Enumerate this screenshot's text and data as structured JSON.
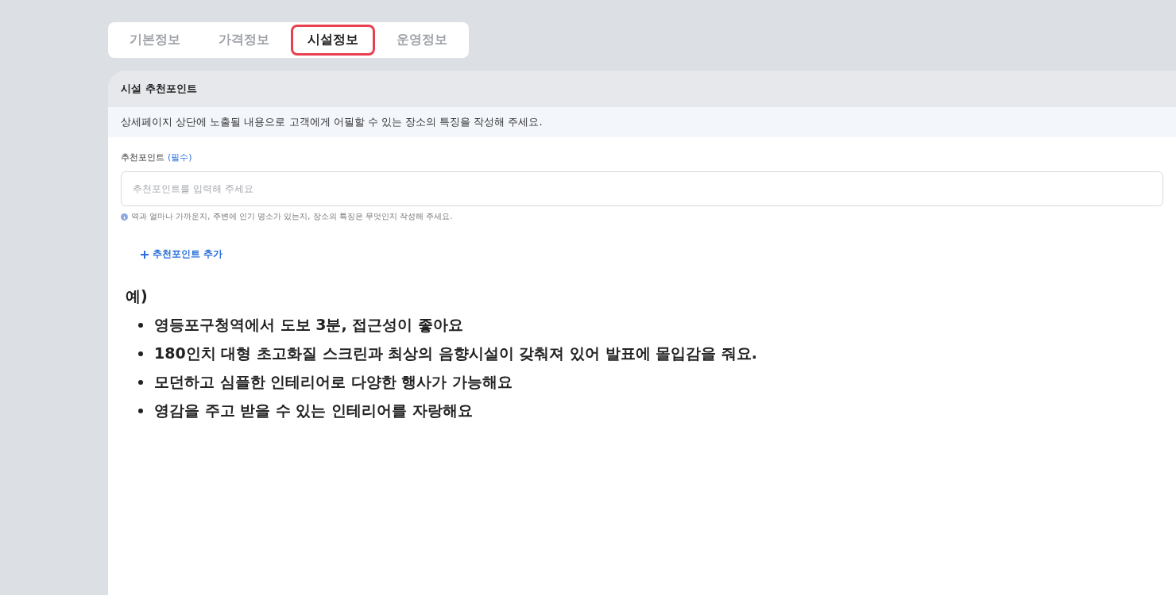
{
  "tabs": [
    {
      "label": "기본정보",
      "selected": false
    },
    {
      "label": "가격정보",
      "selected": false
    },
    {
      "label": "시설정보",
      "selected": true
    },
    {
      "label": "운영정보",
      "selected": false
    }
  ],
  "section": {
    "title": "시설 추천포인트",
    "description": "상세페이지 상단에 노출될 내용으로 고객에게 어필할 수 있는 장소의 특징을 작성해 주세요."
  },
  "field": {
    "label": "추천포인트",
    "required_mark": "(필수)",
    "placeholder": "추천포인트를 입력해 주세요",
    "hint": "역과 얼마나 가까운지, 주변에 인기 명소가 있는지, 장소의 특징은 무엇인지 작성해 주세요."
  },
  "add_button": {
    "label": "추천포인트 추가"
  },
  "example": {
    "heading": "예)",
    "items": [
      "영등포구청역에서 도보 3분, 접근성이 좋아요",
      "180인치 대형 초고화질 스크린과 최상의 음향시설이 갖춰져 있어 발표에 몰입감을 줘요.",
      "모던하고 심플한 인테리어로 다양한 행사가 가능해요",
      "영감을 주고 받을 수 있는 인테리어를 자랑해요"
    ]
  }
}
